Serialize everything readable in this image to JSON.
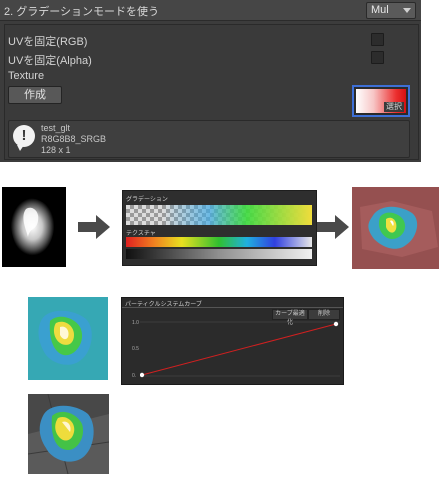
{
  "inspector": {
    "section_title": "2. グラデーションモードを使う",
    "mode_value": "Mul",
    "uv_rgb_label": "UVを固定(RGB)",
    "uv_alpha_label": "UVを固定(Alpha)",
    "texture_label": "Texture",
    "make_button": "作成",
    "select_label": "選択",
    "info": {
      "name": "test_glt",
      "format": "R8G8B8_SRGB",
      "size": "128 x 1"
    }
  },
  "gradient_panel": {
    "gradient_label": "グラデーション",
    "texture_label": "テクスチャ"
  },
  "curve_panel": {
    "title": "パーティクルシステムカーブ",
    "optimize_button": "カーブ最適化",
    "remove_button": "削除",
    "y_max": "1.0",
    "y_mid": "0.5",
    "y_min": "0."
  },
  "colors": {
    "panel_bg": "#3c3c3c",
    "accent_blue": "#3d6fd6",
    "curve_red": "#d02020"
  },
  "icons": {
    "info": "exclamation-icon",
    "flow_arrow": "right-arrow-icon"
  }
}
